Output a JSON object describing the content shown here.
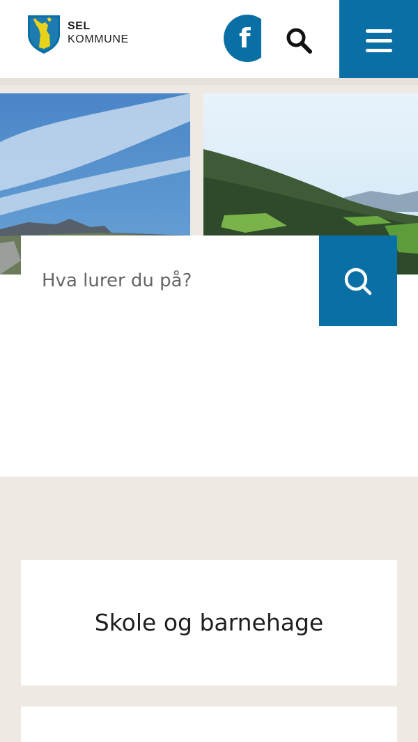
{
  "header": {
    "logo": {
      "line1": "SEL",
      "line2": "KOMMUNE"
    },
    "facebook_letter": "f",
    "icons": {
      "facebook": "facebook-icon",
      "search": "search-icon",
      "menu": "hamburger-menu-icon"
    }
  },
  "search": {
    "placeholder": "Hva lurer du på?",
    "value": ""
  },
  "cards": [
    {
      "label": "Skole og barnehage"
    },
    {
      "label": ""
    }
  ],
  "colors": {
    "brand_blue": "#0a6fa4",
    "beige_background": "#eee9e2",
    "white": "#ffffff",
    "text_dark": "#1f1f1f"
  }
}
